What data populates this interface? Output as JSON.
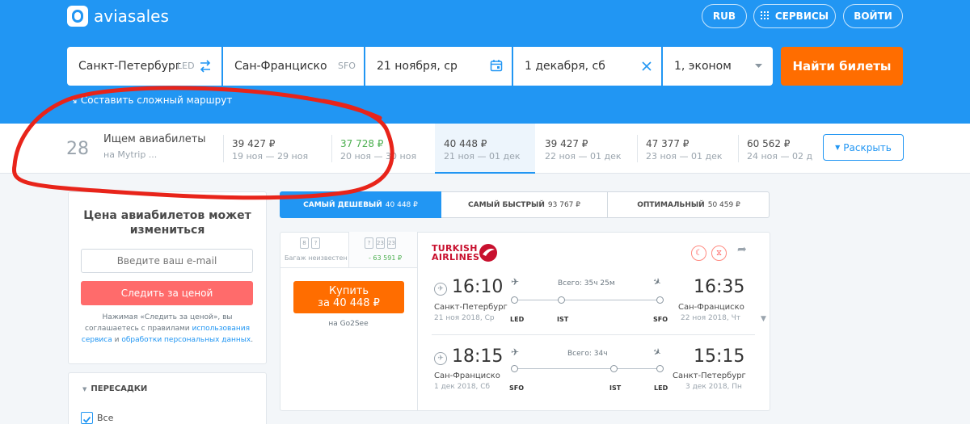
{
  "header": {
    "brand": "aviasales",
    "currency": "RUB",
    "services": "СЕРВИСЫ",
    "login": "ВОЙТИ",
    "primary_color": "#2196f3",
    "accent_color": "#ff6d00"
  },
  "search": {
    "origin": "Санкт-Петербург",
    "origin_code": "LED",
    "destination": "Сан-Франциско",
    "destination_code": "SFO",
    "depart_date": "21 ноября, ср",
    "return_date": "1 декабря, сб",
    "passengers": "1, эконом",
    "submit": "Найти билеты",
    "complex_route": "Составить сложный маршрут"
  },
  "price_strip": {
    "count": "28",
    "title": "Ищем авиабилеты",
    "subtitle": "на Mytrip ...",
    "cells": [
      {
        "price": "39 427 ₽",
        "dates": "19 ноя — 29 ноя"
      },
      {
        "price": "37 728 ₽",
        "dates": "20 ноя — 30 ноя",
        "cheapest": true
      },
      {
        "price": "40 448 ₽",
        "dates": "21 ноя — 01 дек",
        "selected": true
      },
      {
        "price": "39 427 ₽",
        "dates": "22 ноя — 01 дек"
      },
      {
        "price": "47 377 ₽",
        "dates": "23 ноя — 01 дек"
      },
      {
        "price": "60 562 ₽",
        "dates": "24 ноя — 02 д"
      }
    ],
    "expand": "Раскрыть"
  },
  "subscribe": {
    "title": "Цена авиабилетов может измениться",
    "email_placeholder": "Введите ваш e-mail",
    "button": "Следить за ценой",
    "terms_1": "Нажимая «Следить за ценой», вы соглашаетесь с правилами ",
    "terms_link1": "использования сервиса",
    "terms_2": " и ",
    "terms_link2": "обработки персональных данных",
    "terms_3": "."
  },
  "filters": {
    "title": "ПЕРЕСАДКИ",
    "all": "Все"
  },
  "sort": {
    "tabs": [
      {
        "label": "САМЫЙ ДЕШЕВЫЙ",
        "value": "40 448 ₽",
        "active": true
      },
      {
        "label": "САМЫЙ БЫСТРЫЙ",
        "value": "93 767 ₽"
      },
      {
        "label": "ОПТИМАЛЬНЫЙ",
        "value": "50 459 ₽"
      }
    ]
  },
  "ticket": {
    "baggage_unknown": "Багаж неизвестен",
    "baggage_bag1": "8",
    "baggage_bag2": "?",
    "baggage_alt1": "?",
    "baggage_alt2": "23",
    "baggage_alt3": "23",
    "baggage_extra": "- 63 591 ₽",
    "buy_label": "Купить",
    "buy_price": "за 40 448 ₽",
    "agent": "на Go2See",
    "airline": [
      "TURKISH",
      "AIRLINES"
    ],
    "outbound": {
      "dep_time": "16:10",
      "arr_time": "16:35",
      "dep_city": "Санкт-Петербург",
      "dep_date": "21 ноя 2018, Ср",
      "arr_city": "Сан-Франциско",
      "arr_date": "22 ноя 2018, Чт",
      "duration": "Всего: 35ч 25м",
      "from_code": "LED",
      "via_code": "IST",
      "to_code": "SFO"
    },
    "inbound": {
      "dep_time": "18:15",
      "arr_time": "15:15",
      "dep_city": "Сан-Франциско",
      "dep_date": "1 дек 2018, Сб",
      "arr_city": "Санкт-Петербург",
      "arr_date": "3 дек 2018, Пн",
      "duration": "Всего: 34ч",
      "from_code": "SFO",
      "via_code": "IST",
      "to_code": "LED"
    }
  },
  "annotation": {
    "color": "#e8241a"
  }
}
